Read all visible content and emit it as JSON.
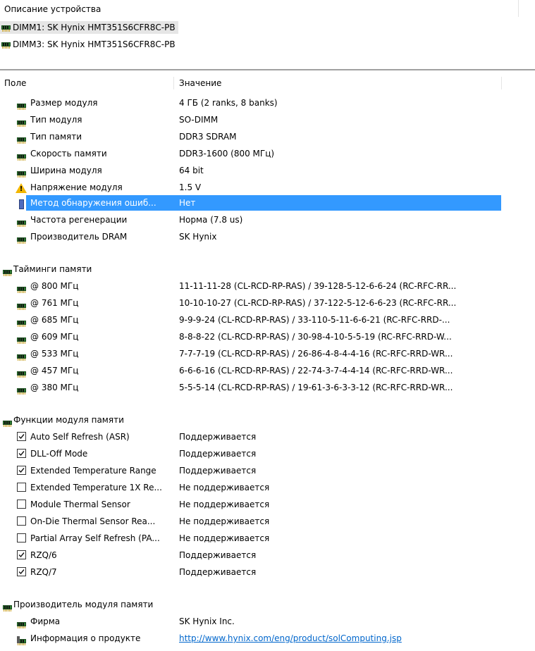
{
  "device_pane": {
    "title": "Описание устройства",
    "devices": [
      {
        "label": "DIMM1: SK Hynix HMT351S6CFR8C-PB"
      },
      {
        "label": "DIMM3: SK Hynix HMT351S6CFR8C-PB"
      }
    ]
  },
  "columns": {
    "field": "Поле",
    "value": "Значение"
  },
  "module": [
    {
      "field": "Размер модуля",
      "value": "4 ГБ (2 ranks, 8 banks)",
      "icon": "ram-icon"
    },
    {
      "field": "Тип модуля",
      "value": "SO-DIMM",
      "icon": "ram-icon"
    },
    {
      "field": "Тип памяти",
      "value": "DDR3 SDRAM",
      "icon": "ram-icon"
    },
    {
      "field": "Скорость памяти",
      "value": "DDR3-1600 (800 МГц)",
      "icon": "ram-icon"
    },
    {
      "field": "Ширина модуля",
      "value": "64 bit",
      "icon": "ram-icon"
    },
    {
      "field": "Напряжение модуля",
      "value": "1.5 V",
      "icon": "warning-icon"
    },
    {
      "field": "Метод обнаружения ошиб...",
      "value": "Нет",
      "icon": "chip-icon"
    },
    {
      "field": "Частота регенерации",
      "value": "Норма (7.8 us)",
      "icon": "ram-icon"
    },
    {
      "field": "Производитель DRAM",
      "value": "SK Hynix",
      "icon": "ram-icon"
    }
  ],
  "timings": {
    "title": "Тайминги памяти",
    "rows": [
      {
        "field": "@ 800 МГц",
        "value": "11-11-11-28  (CL-RCD-RP-RAS) / 39-128-5-12-6-6-24  (RC-RFC-RR..."
      },
      {
        "field": "@ 761 МГц",
        "value": "10-10-10-27  (CL-RCD-RP-RAS) / 37-122-5-12-6-6-23  (RC-RFC-RR..."
      },
      {
        "field": "@ 685 МГц",
        "value": "9-9-9-24  (CL-RCD-RP-RAS) / 33-110-5-11-6-6-21  (RC-RFC-RRD-..."
      },
      {
        "field": "@ 609 МГц",
        "value": "8-8-8-22  (CL-RCD-RP-RAS) / 30-98-4-10-5-5-19  (RC-RFC-RRD-W..."
      },
      {
        "field": "@ 533 МГц",
        "value": "7-7-7-19  (CL-RCD-RP-RAS) / 26-86-4-8-4-4-16  (RC-RFC-RRD-WR..."
      },
      {
        "field": "@ 457 МГц",
        "value": "6-6-6-16  (CL-RCD-RP-RAS) / 22-74-3-7-4-4-14  (RC-RFC-RRD-WR..."
      },
      {
        "field": "@ 380 МГц",
        "value": "5-5-5-14  (CL-RCD-RP-RAS) / 19-61-3-6-3-3-12  (RC-RFC-RRD-WR..."
      }
    ]
  },
  "features": {
    "title": "Функции модуля памяти",
    "rows": [
      {
        "field": "Auto Self Refresh (ASR)",
        "value": "Поддерживается",
        "checked": true
      },
      {
        "field": "DLL-Off Mode",
        "value": "Поддерживается",
        "checked": true
      },
      {
        "field": "Extended Temperature Range",
        "value": "Поддерживается",
        "checked": true
      },
      {
        "field": "Extended Temperature 1X Re...",
        "value": "Не поддерживается",
        "checked": false
      },
      {
        "field": "Module Thermal Sensor",
        "value": "Не поддерживается",
        "checked": false
      },
      {
        "field": "On-Die Thermal Sensor Rea...",
        "value": "Не поддерживается",
        "checked": false
      },
      {
        "field": "Partial Array Self Refresh (PA...",
        "value": "Не поддерживается",
        "checked": false
      },
      {
        "field": "RZQ/6",
        "value": "Поддерживается",
        "checked": true
      },
      {
        "field": "RZQ/7",
        "value": "Поддерживается",
        "checked": true
      }
    ]
  },
  "manufacturer": {
    "title": "Производитель модуля памяти",
    "rows": [
      {
        "field": "Фирма",
        "value": "SK Hynix Inc."
      },
      {
        "field": "Информация о продукте",
        "value": "http://www.hynix.com/eng/product/solComputing.jsp"
      }
    ]
  },
  "colors": {
    "selection": "#3399ff",
    "link": "#0066cc",
    "ram_icon": "#2e7d32",
    "warning": "#f2b600"
  }
}
